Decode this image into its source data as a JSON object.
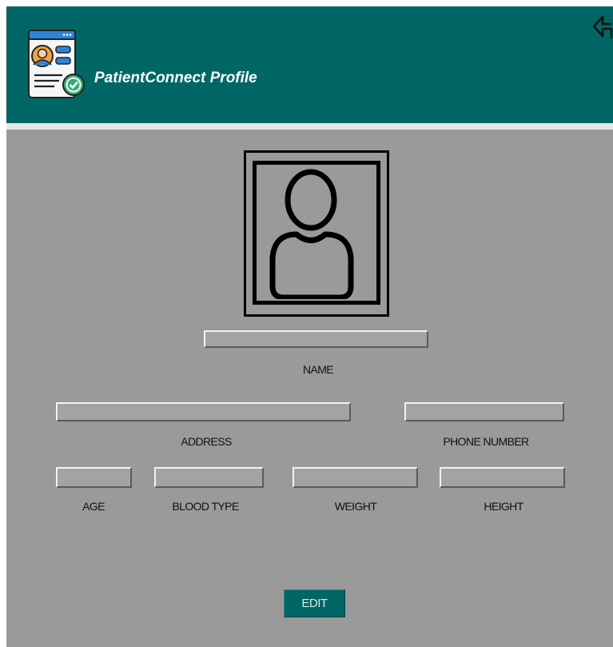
{
  "header": {
    "title": "PatientConnect Profile",
    "logo_icon": "patient-id-card-icon",
    "back_icon": "back-arrow-icon",
    "background_color": "#006666"
  },
  "profile": {
    "photo_icon": "user-avatar-icon"
  },
  "fields": {
    "name": {
      "label": "NAME",
      "value": ""
    },
    "address": {
      "label": "ADDRESS",
      "value": ""
    },
    "phone_number": {
      "label": "PHONE NUMBER",
      "value": ""
    },
    "age": {
      "label": "AGE",
      "value": ""
    },
    "blood_type": {
      "label": "BLOOD TYPE",
      "value": ""
    },
    "weight": {
      "label": "WEIGHT",
      "value": ""
    },
    "height": {
      "label": "HEIGHT",
      "value": ""
    }
  },
  "actions": {
    "edit_label": "EDIT"
  },
  "colors": {
    "accent": "#006666",
    "panel_background": "#9a9a9a"
  }
}
